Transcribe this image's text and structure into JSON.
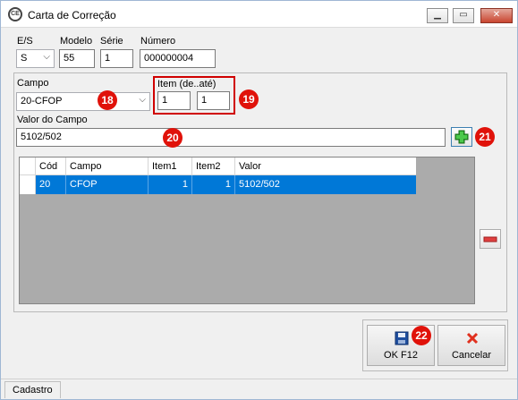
{
  "window": {
    "title": "Carta de Correção"
  },
  "es": {
    "label": "E/S",
    "value": "S"
  },
  "modelo": {
    "label": "Modelo",
    "value": "55"
  },
  "serie": {
    "label": "Série",
    "value": "1"
  },
  "numero": {
    "label": "Número",
    "value": "000000004"
  },
  "campo": {
    "label": "Campo",
    "value": "20-CFOP"
  },
  "item_range": {
    "label": "Item (de..até)",
    "from": "1",
    "to": "1"
  },
  "valor_campo": {
    "label": "Valor do Campo",
    "value": "5102/502"
  },
  "grid": {
    "columns": [
      "Cód",
      "Campo",
      "Item1",
      "Item2",
      "Valor"
    ],
    "rows": [
      {
        "cod": "20",
        "campo": "CFOP",
        "item1": "1",
        "item2": "1",
        "valor": "5102/502"
      }
    ]
  },
  "buttons": {
    "ok": "OK  F12",
    "cancel": "Cancelar"
  },
  "status": {
    "tab": "Cadastro"
  },
  "callouts": {
    "c18": "18",
    "c19": "19",
    "c20": "20",
    "c21": "21",
    "c22": "22"
  },
  "colors": {
    "selection": "#0078d7",
    "callout": "#e0120a",
    "highlight_box": "#d00000"
  },
  "icons": [
    "app-icon",
    "minimize-icon",
    "maximize-icon",
    "close-icon",
    "plus-icon",
    "minus-icon",
    "save-icon",
    "cancel-x-icon"
  ]
}
